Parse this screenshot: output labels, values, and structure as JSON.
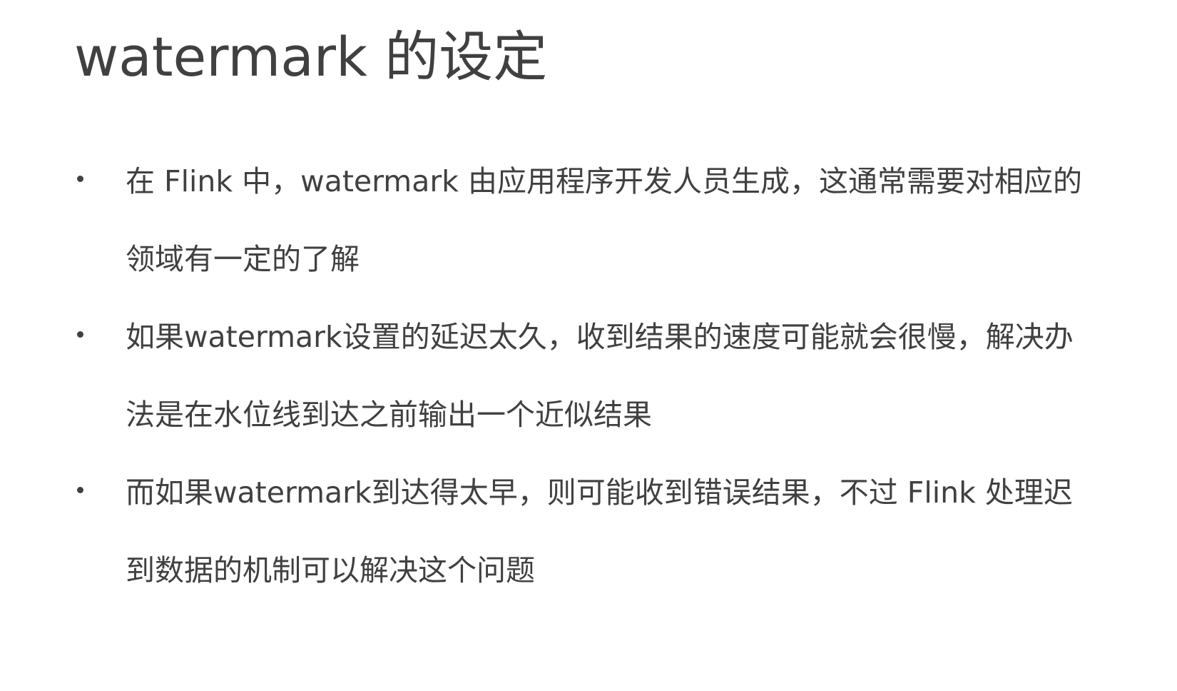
{
  "slide": {
    "title": "watermark 的设定",
    "bullets": [
      {
        "lines": [
          "在 Flink 中，watermark 由应用程序开发人员生成，这通常需要对相应的",
          "领域有一定的了解"
        ]
      },
      {
        "lines": [
          "如果watermark设置的延迟太久，收到结果的速度可能就会很慢，解决办",
          "法是在水位线到达之前输出一个近似结果"
        ]
      },
      {
        "lines": [
          "而如果watermark到达得太早，则可能收到错误结果，不过 Flink 处理迟",
          "到数据的机制可以解决这个问题"
        ]
      }
    ]
  },
  "colors": {
    "text": "#404040",
    "background": "#ffffff"
  }
}
